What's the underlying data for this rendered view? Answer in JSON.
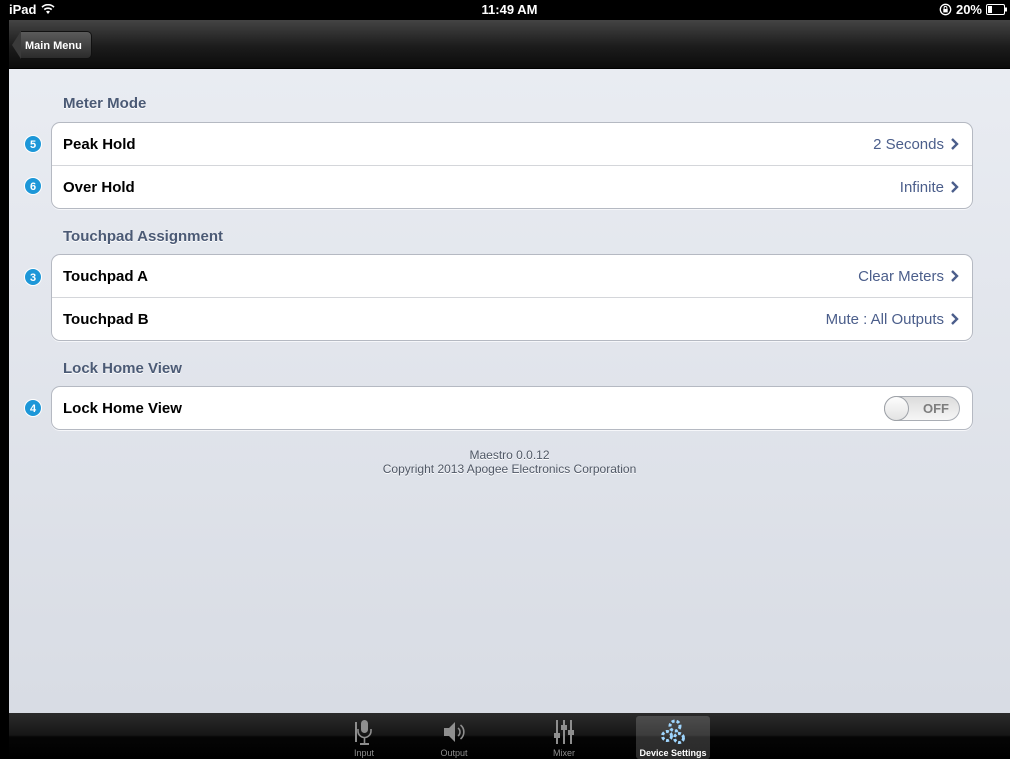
{
  "status_bar": {
    "device": "iPad",
    "time": "11:49 AM",
    "battery": "20%"
  },
  "nav": {
    "back_label": "Main Menu"
  },
  "sections": {
    "meter_mode": {
      "header": "Meter Mode",
      "rows": [
        {
          "badge": "5",
          "label": "Peak Hold",
          "value": "2 Seconds"
        },
        {
          "badge": "6",
          "label": "Over Hold",
          "value": "Infinite"
        }
      ]
    },
    "touchpad": {
      "header": "Touchpad Assignment",
      "rows": [
        {
          "badge": "3",
          "label": "Touchpad A",
          "value": "Clear Meters"
        },
        {
          "label": "Touchpad B",
          "value": "Mute : All Outputs"
        }
      ]
    },
    "lock_home": {
      "header": "Lock Home View",
      "rows": [
        {
          "badge": "4",
          "label": "Lock Home View",
          "toggle": "OFF"
        }
      ]
    }
  },
  "footer": {
    "version": "Maestro 0.0.12",
    "copyright": "Copyright 2013 Apogee Electronics Corporation"
  },
  "tabs": [
    {
      "label": "Input",
      "icon": "microphone-icon"
    },
    {
      "label": "Output",
      "icon": "speaker-icon"
    },
    {
      "label": "Mixer",
      "icon": "mixer-faders-icon"
    },
    {
      "label": "Device Settings",
      "icon": "gears-icon",
      "selected": true
    }
  ],
  "colors": {
    "badge": "#1d97d8",
    "section_header": "#4b5a75",
    "cell_value": "#4b5e8b"
  }
}
